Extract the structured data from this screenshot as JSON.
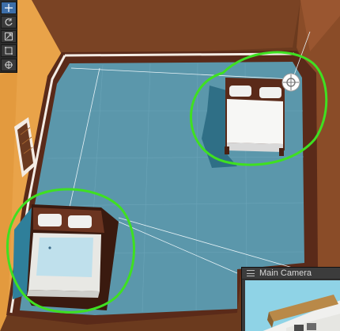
{
  "toolbar": {
    "tools": [
      {
        "name": "move-tool",
        "active": true
      },
      {
        "name": "rotate-tool",
        "active": false
      },
      {
        "name": "scale-tool",
        "active": false
      },
      {
        "name": "rect-tool",
        "active": false
      },
      {
        "name": "transform-tool",
        "active": false
      }
    ]
  },
  "camera_preview": {
    "title": "Main Camera"
  },
  "scene": {
    "floor_color": "#5b97ab",
    "wall_color": "#e9a349",
    "trim_color": "#5a2a19",
    "annotation_color": "#3fe021",
    "objects": [
      "bed-upper-right",
      "bed-lower-left",
      "window",
      "scene-light-gizmo"
    ]
  }
}
